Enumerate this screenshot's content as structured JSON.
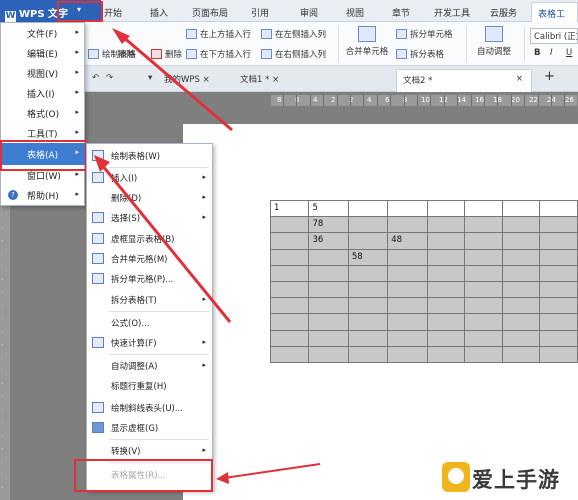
{
  "ribbon_tabs": {
    "wps_button": "WPS 文字",
    "tabs": [
      "开始",
      "插入",
      "页面布局",
      "引用",
      "审阅",
      "视图",
      "章节",
      "开发工具",
      "云服务",
      "表格工具"
    ]
  },
  "ribbon": {
    "draw_table": "绘制表格",
    "erase": "擦除",
    "delete": "删除",
    "insert_above": "在上方插入行",
    "insert_below": "在下方插入行",
    "insert_left": "在左侧插入列",
    "insert_right": "在右侧插入列",
    "merge_cells": "合并单元格",
    "split_cells": "拆分单元格",
    "split_table": "拆分表格",
    "auto_adjust": "自动调整",
    "font": "Calibri (正文",
    "bold": "B",
    "italic": "I",
    "underline": "U"
  },
  "doc_tabs": {
    "my_wps": "我的WPS",
    "doc1": "文档1 *",
    "doc2": "文档2 *",
    "new_tab": "+"
  },
  "ruler": {
    "numbers": [
      "8",
      "6",
      "4",
      "2",
      "2",
      "4",
      "6",
      "8",
      "10",
      "12",
      "14",
      "16",
      "18",
      "20",
      "22",
      "24",
      "26"
    ]
  },
  "menu1": {
    "items": [
      {
        "label": "文件(F)"
      },
      {
        "label": "编辑(E)"
      },
      {
        "label": "视图(V)"
      },
      {
        "label": "插入(I)"
      },
      {
        "label": "格式(O)"
      },
      {
        "label": "工具(T)"
      },
      {
        "label": "表格(A)"
      },
      {
        "label": "窗口(W)"
      },
      {
        "label": "帮助(H)"
      }
    ]
  },
  "menu2": {
    "items": [
      {
        "label": "绘制表格(W)"
      },
      {
        "label": "插入(I)"
      },
      {
        "label": "删除(D)"
      },
      {
        "label": "选择(S)"
      },
      {
        "label": "虚框显示表格(B)"
      },
      {
        "label": "合并单元格(M)"
      },
      {
        "label": "拆分单元格(P)..."
      },
      {
        "label": "拆分表格(T)"
      },
      {
        "label": "公式(O)..."
      },
      {
        "label": "快速计算(F)"
      },
      {
        "label": "自动调整(A)"
      },
      {
        "label": "标题行重复(H)"
      },
      {
        "label": "绘制斜线表头(U)..."
      },
      {
        "label": "显示虚框(G)"
      },
      {
        "label": "转换(V)"
      },
      {
        "label": "表格属性(R)..."
      }
    ]
  },
  "table": {
    "rows": [
      [
        "1",
        "5",
        "",
        "",
        "",
        "",
        "",
        ""
      ],
      [
        "",
        "78",
        "",
        "",
        "",
        "",
        "",
        ""
      ],
      [
        "",
        "36",
        "",
        "48",
        "",
        "",
        "",
        ""
      ],
      [
        "",
        "",
        "58",
        "",
        "",
        "",
        "",
        ""
      ],
      [
        "",
        "",
        "",
        "",
        "",
        "",
        "",
        ""
      ],
      [
        "",
        "",
        "",
        "",
        "",
        "",
        "",
        ""
      ],
      [
        "",
        "",
        "",
        "",
        "",
        "",
        "",
        ""
      ],
      [
        "",
        "",
        "",
        "",
        "",
        "",
        "",
        ""
      ],
      [
        "",
        "",
        "",
        "",
        "",
        "",
        "",
        ""
      ],
      [
        "",
        "",
        "",
        "",
        "",
        "",
        "",
        ""
      ]
    ]
  },
  "watermark": {
    "text": "爱上手游网"
  },
  "colors": {
    "accent": "#2a63b8",
    "highlight": "#3f7dd1",
    "annotation_red": "#e0313a"
  }
}
